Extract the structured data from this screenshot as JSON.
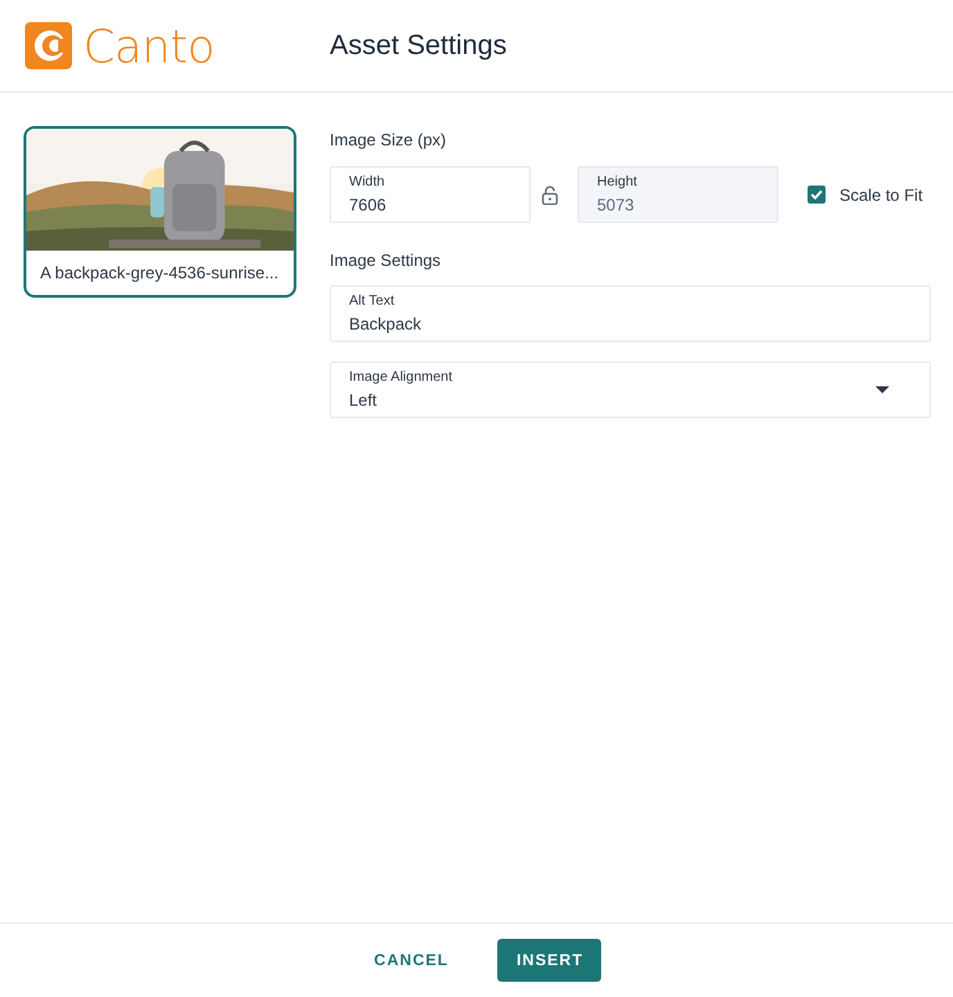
{
  "logo": {
    "text": "Canto"
  },
  "title": "Asset Settings",
  "asset": {
    "kind": "picture",
    "name": "A backpack-grey-4536-sunrise...",
    "selected": true
  },
  "image_size": {
    "label": "Image Size (px)",
    "fields": [
      {
        "label": "Width",
        "value": "7606",
        "disabled": false
      },
      {
        "label": "Height",
        "value": "5073",
        "disabled": true
      }
    ],
    "scale_to_fit": {
      "label": "Scale to Fit",
      "checked": true
    }
  },
  "image_settings": {
    "label": "Image Settings",
    "alt_text": {
      "label": "Alt Text",
      "value": "Backpack"
    },
    "alignment": {
      "label": "Image Alignment",
      "value": "Left"
    }
  },
  "buttons": [
    {
      "label": "CANCEL",
      "kind": "text"
    },
    {
      "label": "INSERT",
      "kind": "primary"
    }
  ]
}
